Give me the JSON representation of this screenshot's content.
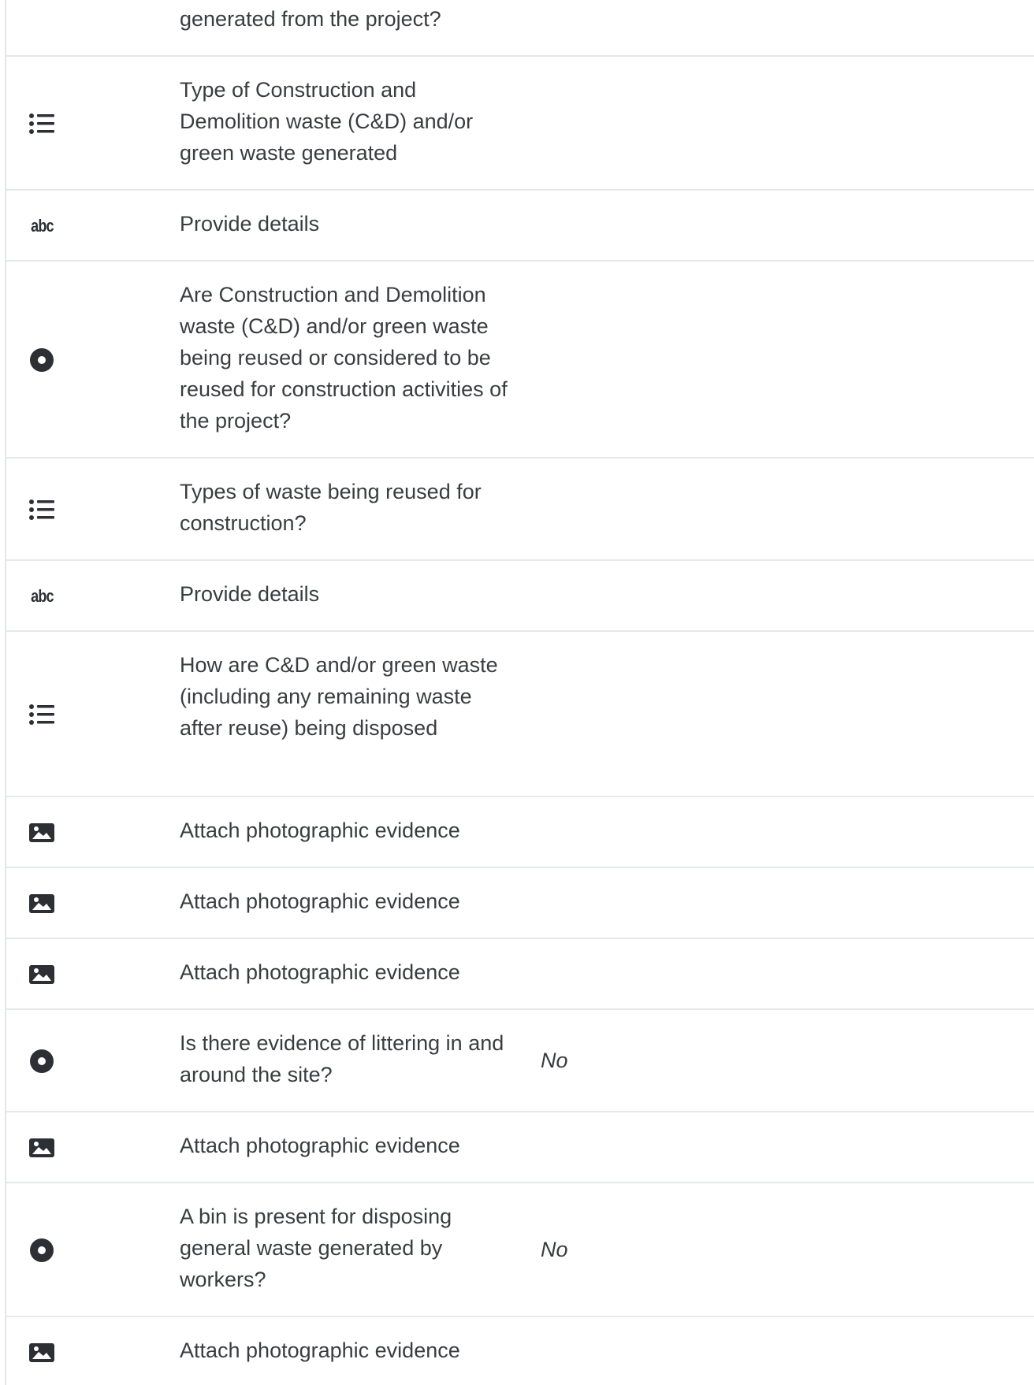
{
  "rows": [
    {
      "icon": "none",
      "question": "generated from the project?",
      "answer": ""
    },
    {
      "icon": "list-icon",
      "question": "Type of Construction and Demolition waste (C&D) and/or green waste generated",
      "answer": ""
    },
    {
      "icon": "text-abc-icon",
      "icon_text": "abc",
      "question": "Provide details",
      "answer": ""
    },
    {
      "icon": "radio-icon",
      "question": "Are Construction and Demolition waste (C&D) and/or green waste being reused or considered to be reused for construction activities of the project?",
      "answer": ""
    },
    {
      "icon": "list-icon",
      "question": "Types of waste being reused for construction?",
      "answer": ""
    },
    {
      "icon": "text-abc-icon",
      "icon_text": "abc",
      "question": "Provide details",
      "answer": ""
    },
    {
      "icon": "list-icon",
      "question": "How are C&D and/or green waste (including any remaining waste after reuse) being disposed",
      "answer": ""
    },
    {
      "icon": "image-icon",
      "question": "Attach photographic evidence",
      "answer": ""
    },
    {
      "icon": "image-icon",
      "question": "Attach photographic evidence",
      "answer": ""
    },
    {
      "icon": "image-icon",
      "question": "Attach photographic evidence",
      "answer": ""
    },
    {
      "icon": "radio-icon",
      "question": "Is there evidence of littering in and around the site?",
      "answer": "No"
    },
    {
      "icon": "image-icon",
      "question": "Attach photographic evidence",
      "answer": ""
    },
    {
      "icon": "radio-icon",
      "question": "A bin is present for disposing general waste generated by workers?",
      "answer": "No"
    },
    {
      "icon": "image-icon",
      "question": "Attach photographic evidence",
      "answer": ""
    }
  ]
}
